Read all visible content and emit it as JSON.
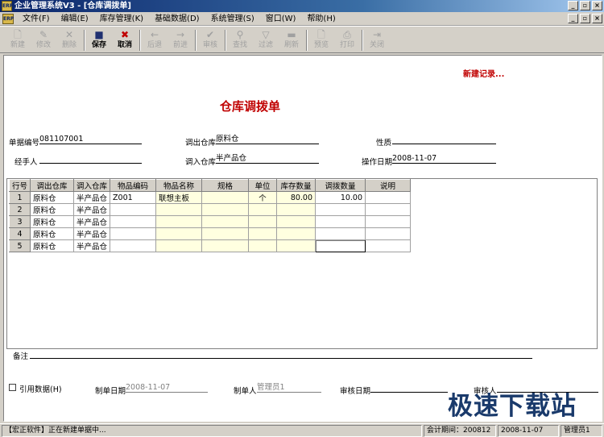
{
  "window": {
    "app_icon_text": "ERP",
    "title": "企业管理系统V3 - [仓库调拨单]",
    "minimize": "_",
    "restore": "▫",
    "close": "×"
  },
  "menubar": {
    "items": [
      "文件(F)",
      "编辑(E)",
      "库存管理(K)",
      "基础数据(D)",
      "系统管理(S)",
      "窗口(W)",
      "帮助(H)"
    ]
  },
  "toolbar": {
    "new": "新建",
    "edit": "修改",
    "delete": "删除",
    "save": "保存",
    "cancel": "取消",
    "back": "后退",
    "forward": "前进",
    "audit": "审核",
    "find": "查找",
    "filter": "过滤",
    "refresh": "刷新",
    "preview": "预览",
    "print": "打印",
    "close": "关闭"
  },
  "form": {
    "new_record": "新建记录...",
    "doc_title": "仓库调拨单",
    "doc_no_label": "单据编号",
    "doc_no": "081107001",
    "out_wh_label": "调出仓库",
    "out_wh": "原料仓",
    "nature_label": "性质",
    "nature": "",
    "handler_label": "经手人",
    "handler": "",
    "in_wh_label": "调入仓库",
    "in_wh": "半产品仓",
    "op_date_label": "操作日期",
    "op_date": "2008-11-07",
    "remark_label": "备注",
    "remark": "",
    "ref_data_label": "引用数据(H)",
    "made_date_label": "制单日期",
    "made_date": "2008-11-07",
    "maker_label": "制单人",
    "maker": "管理员1",
    "audit_date_label": "审核日期",
    "audit_date": "",
    "auditor_label": "审核人",
    "auditor": ""
  },
  "grid": {
    "headers": [
      "行号",
      "调出仓库",
      "调入仓库",
      "物品编码",
      "物品名称",
      "规格",
      "单位",
      "库存数量",
      "调拨数量",
      "说明"
    ],
    "rows": [
      {
        "no": "1",
        "out": "原料仓",
        "in": "半产品仓",
        "code": "Z001",
        "name": "联想主板",
        "spec": "",
        "unit": "个",
        "stock": "80.00",
        "qty": "10.00",
        "note": ""
      },
      {
        "no": "2",
        "out": "原料仓",
        "in": "半产品仓",
        "code": "",
        "name": "",
        "spec": "",
        "unit": "",
        "stock": "",
        "qty": "",
        "note": ""
      },
      {
        "no": "3",
        "out": "原料仓",
        "in": "半产品仓",
        "code": "",
        "name": "",
        "spec": "",
        "unit": "",
        "stock": "",
        "qty": "",
        "note": ""
      },
      {
        "no": "4",
        "out": "原料仓",
        "in": "半产品仓",
        "code": "",
        "name": "",
        "spec": "",
        "unit": "",
        "stock": "",
        "qty": "",
        "note": ""
      },
      {
        "no": "5",
        "out": "原料仓",
        "in": "半产品仓",
        "code": "",
        "name": "",
        "spec": "",
        "unit": "",
        "stock": "",
        "qty": "",
        "note": ""
      }
    ]
  },
  "statusbar": {
    "message": "【宏正软件】正在新建单据中...",
    "period": "会计期间：200812",
    "date": "2008-11-07",
    "user": "管理员1"
  },
  "watermark": "极速下载站"
}
